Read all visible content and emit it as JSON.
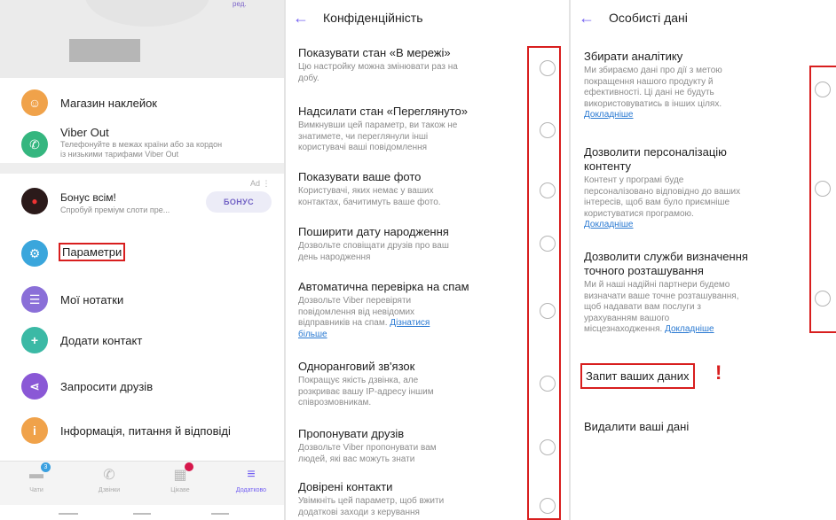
{
  "colors": {
    "accent": "#7360f2",
    "link": "#2979d2",
    "highlight": "#d81e1e"
  },
  "left": {
    "top_edit": "ред.",
    "stickers": "Магазин наклейок",
    "viber_out": {
      "title": "Viber Out",
      "sub1": "Телефонуйте в межах країни або за кордон",
      "sub2": "із низькими тарифами Viber Out"
    },
    "ad": {
      "tag": "Ad ⋮",
      "title": "Бонус всім!",
      "sub": "Спробуй преміум слоти пре...",
      "button": "БОНУС"
    },
    "menu": [
      "Параметри",
      "Мої нотатки",
      "Додати контакт",
      "Запросити друзів",
      "Інформація, питання й відповіді"
    ],
    "nav": [
      {
        "label": "Чати",
        "badge": "3"
      },
      {
        "label": "Дзвінки"
      },
      {
        "label": "Цікаве"
      },
      {
        "label": "Додатково"
      }
    ]
  },
  "privacy": {
    "title": "Конфіденційність",
    "items": [
      {
        "title": "Показувати стан «В мережі»",
        "desc": [
          "Цю настройку можна змінювати раз на",
          "добу."
        ]
      },
      {
        "title": "Надсилати стан «Переглянуто»",
        "desc": [
          "Вимкнувши цей параметр, ви також не",
          "знатимете, чи переглянули інші",
          "користувачі ваші повідомлення"
        ]
      },
      {
        "title": "Показувати ваше фото",
        "desc": [
          "Користувачі, яких немає у ваших",
          "контактах, бачитимуть ваше фото."
        ]
      },
      {
        "title": "Поширити дату народження",
        "desc": [
          "Дозвольте сповіщати друзів про ваш",
          "день народження"
        ]
      },
      {
        "title": "Автоматична перевірка на спам",
        "desc": [
          "Дозвольте Viber перевіряти",
          "повідомлення від невідомих",
          "відправників на спам."
        ],
        "link": "Дізнатися",
        "link2": "більше"
      },
      {
        "title": "Одноранговий зв'язок",
        "desc": [
          "Покращує якість дзвінка, але",
          "розкриває вашу IP-адресу іншим",
          "співрозмовникам."
        ]
      },
      {
        "title": "Пропонувати друзів",
        "desc": [
          "Дозвольте Viber пропонувати вам",
          "людей, які вас можуть знати"
        ]
      },
      {
        "title": "Довірені контакти",
        "desc": [
          "Увімкніть цей параметр, щоб вжити",
          "додаткові заходи з керування"
        ]
      }
    ]
  },
  "personal": {
    "title": "Особисті дані",
    "items": [
      {
        "title": [
          "Збирати аналітику"
        ],
        "desc": [
          "Ми збираємо дані про дії з метою",
          "покращення нашого продукту й",
          "ефективності. Ці дані не будуть",
          "використовуватись в інших цілях."
        ],
        "link": "Докладніше"
      },
      {
        "title": [
          "Дозволити персоналізацію",
          "контенту"
        ],
        "desc": [
          "Контент у програмі буде",
          "персоналізовано відповідно до ваших",
          "інтересів, щоб вам було приємніше",
          "користуватися програмою."
        ],
        "link": "Докладніше"
      },
      {
        "title": [
          "Дозволити служби визначення",
          "точного розташування"
        ],
        "desc": [
          "Ми й наші надійні партнери будемо",
          "визначати ваше точне розташування,",
          "щоб надавати вам послуги з",
          "урахуванням вашого"
        ],
        "desc_last": "місцезнаходження.",
        "link": "Докладніше"
      }
    ],
    "request": "Запит ваших даних",
    "exclaim": "!",
    "delete": "Видалити ваші дані"
  }
}
